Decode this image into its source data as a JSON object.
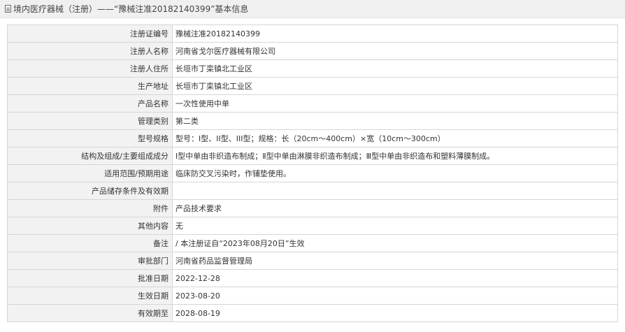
{
  "header": {
    "title": "境内医疗器械（注册）——“豫械注准20182140399”基本信息",
    "icon": "document-icon"
  },
  "rows": [
    {
      "label": "注册证编号",
      "value": "豫械注准20182140399"
    },
    {
      "label": "注册人名称",
      "value": "河南省戈尔医疗器械有限公司"
    },
    {
      "label": "注册人住所",
      "value": "长垣市丁栾镇北工业区"
    },
    {
      "label": "生产地址",
      "value": "长垣市丁栾镇北工业区"
    },
    {
      "label": "产品名称",
      "value": "一次性使用中单"
    },
    {
      "label": "管理类别",
      "value": "第二类"
    },
    {
      "label": "型号规格",
      "value": "型号：I型、II型、III型；规格：长（20cm～400cm）×宽（10cm～300cm）"
    },
    {
      "label": "结构及组成/主要组成成分",
      "value": "Ⅰ型中单由非织造布制成；Ⅱ型中单由淋膜非织造布制成；Ⅲ型中单由非织造布和塑料薄膜制成。"
    },
    {
      "label": "适用范围/预期用途",
      "value": "临床防交叉污染时，作铺垫使用。"
    },
    {
      "label": "产品储存条件及有效期",
      "value": ""
    },
    {
      "label": "附件",
      "value": "产品技术要求"
    },
    {
      "label": "其他内容",
      "value": "无"
    },
    {
      "label": "备注",
      "value": "/ 本注册证自“2023年08月20日”生效"
    },
    {
      "label": "审批部门",
      "value": "河南省药品监督管理局"
    },
    {
      "label": "批准日期",
      "value": "2022-12-28"
    },
    {
      "label": "生效日期",
      "value": "2023-08-20"
    },
    {
      "label": "有效期至",
      "value": "2028-08-19"
    }
  ]
}
